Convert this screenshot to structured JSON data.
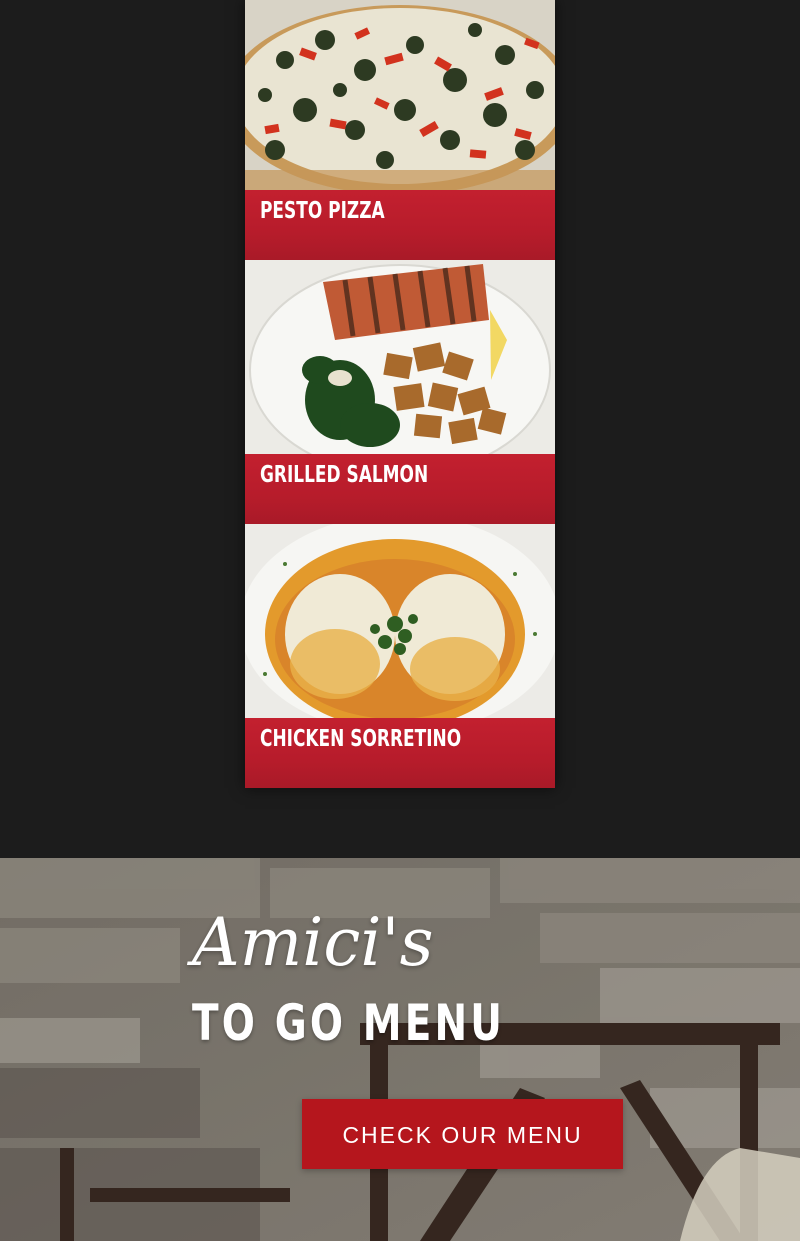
{
  "featured": {
    "items": [
      {
        "label": "PESTO PIZZA",
        "image_icon": "pesto-pizza-photo"
      },
      {
        "label": "GRILLED SALMON",
        "image_icon": "grilled-salmon-photo"
      },
      {
        "label": "CHICKEN SORRETINO",
        "image_icon": "chicken-sorretino-photo"
      }
    ],
    "banner_color": "#c3202f"
  },
  "togo": {
    "script_title": "Amici's",
    "subtitle": "TO GO MENU",
    "cta_label": "CHECK OUR MENU",
    "cta_color": "#b5161d"
  },
  "colors": {
    "page_background": "#1c1c1c"
  }
}
